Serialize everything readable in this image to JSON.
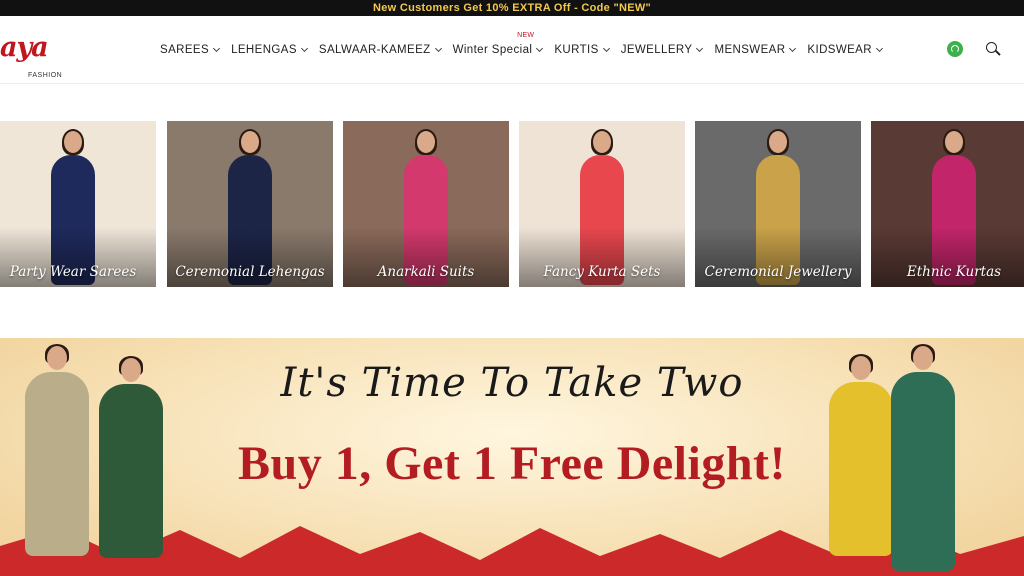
{
  "announcement": "New Customers Get 10% EXTRA Off - Code \"NEW\"",
  "brand": {
    "word": "aya",
    "sub": "FASHION"
  },
  "nav": [
    {
      "label": "SAREES",
      "badge": ""
    },
    {
      "label": "LEHENGAS",
      "badge": ""
    },
    {
      "label": "SALWAAR-KAMEEZ",
      "badge": ""
    },
    {
      "label": "Winter Special",
      "badge": "NEW"
    },
    {
      "label": "KURTIS",
      "badge": ""
    },
    {
      "label": "JEWELLERY",
      "badge": ""
    },
    {
      "label": "MENSWEAR",
      "badge": ""
    },
    {
      "label": "KIDSWEAR",
      "badge": ""
    }
  ],
  "icons": {
    "chat": "whatsapp-icon",
    "search": "search-icon",
    "chevron": "chevron-down-icon"
  },
  "tiles": [
    {
      "label": "Party Wear Sarees",
      "bg": "#efe6d8",
      "garment": "#1f2a5c"
    },
    {
      "label": "Ceremonial Lehengas",
      "bg": "#8a7a6c",
      "garment": "#1d2547"
    },
    {
      "label": "Anarkali Suits",
      "bg": "#8a6a5a",
      "garment": "#d3396c"
    },
    {
      "label": "Fancy Kurta Sets",
      "bg": "#efe3d6",
      "garment": "#e8474e"
    },
    {
      "label": "Ceremonial Jewellery",
      "bg": "#6a6a6a",
      "garment": "#c9a24a"
    },
    {
      "label": "Ethnic Kurtas",
      "bg": "#5a3a34",
      "garment": "#c2256a"
    }
  ],
  "banner": {
    "tagline": "It's Time To Take Two",
    "headline": "Buy 1, Get 1 Free Delight!",
    "accent": "#b31d22",
    "zigzag": "#cc2a2a"
  },
  "banner_models": [
    {
      "name": "model-beige-saree",
      "garment": "#b9ad8a"
    },
    {
      "name": "model-green-suit",
      "garment": "#2f5a3a"
    },
    {
      "name": "model-yellow-kurta",
      "garment": "#e3c02c"
    },
    {
      "name": "model-floral-lehenga",
      "garment": "#2e6e57"
    }
  ]
}
